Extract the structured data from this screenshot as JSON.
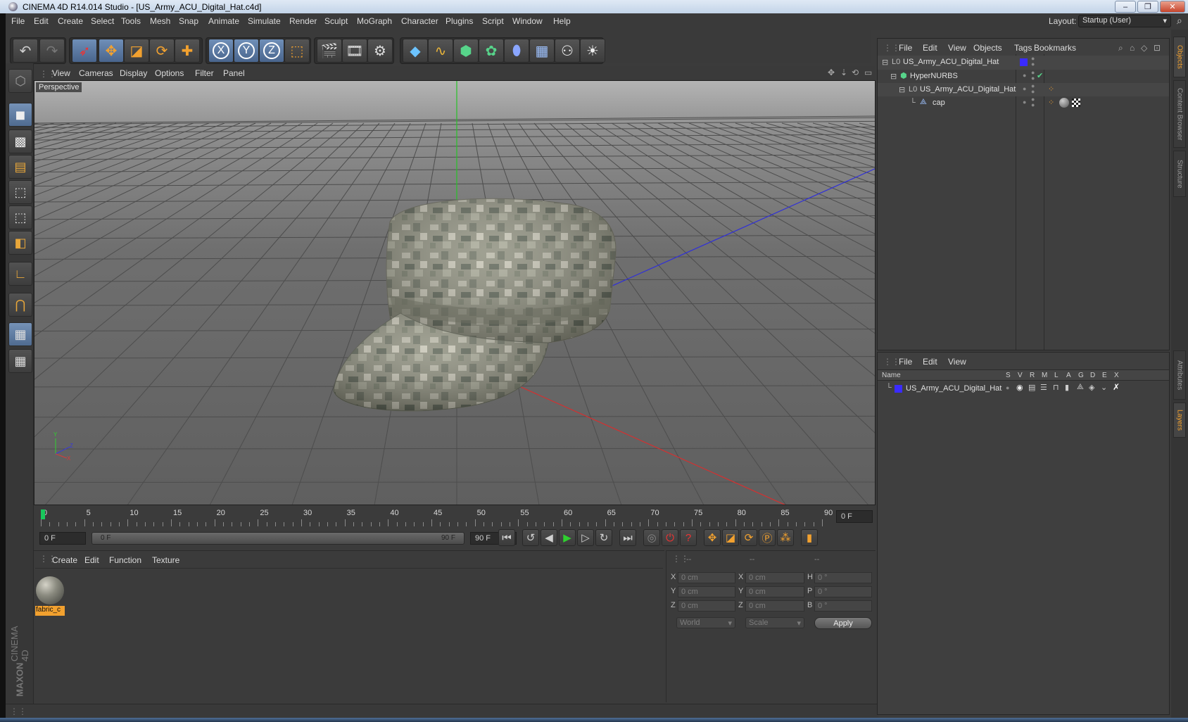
{
  "window": {
    "title": "CINEMA 4D R14.014 Studio - [US_Army_ACU_Digital_Hat.c4d]",
    "min": "–",
    "max": "❐",
    "close": "✕"
  },
  "menubar": {
    "items": [
      "File",
      "Edit",
      "Create",
      "Select",
      "Tools",
      "Mesh",
      "Snap",
      "Animate",
      "Simulate",
      "Render",
      "Sculpt",
      "MoGraph",
      "Character",
      "Plugins",
      "Script",
      "Window",
      "Help"
    ],
    "layout_label": "Layout:",
    "layout_value": "Startup (User)"
  },
  "toolbar": {
    "icons": [
      "undo-icon",
      "redo-icon",
      "live-selection-icon",
      "move-icon",
      "scale-icon",
      "rotate-icon",
      "add-icon",
      "x-axis-icon",
      "y-axis-icon",
      "z-axis-icon",
      "world-coords-icon",
      "render-view-icon",
      "render-picture-viewer-icon",
      "render-settings-icon",
      "cube-icon",
      "spline-icon",
      "nurbs-icon",
      "array-icon",
      "deformer-icon",
      "floor-icon",
      "camera-icon",
      "light-icon"
    ],
    "x": "X",
    "y": "Y",
    "z": "Z"
  },
  "viewport": {
    "menu": [
      "View",
      "Cameras",
      "Display",
      "Options",
      "Filter",
      "Panel"
    ],
    "label": "Perspective",
    "axis_y": "Y",
    "axis_z": "Z",
    "axis_x": "X"
  },
  "timeline": {
    "ticks": [
      "0",
      "5",
      "10",
      "15",
      "20",
      "25",
      "30",
      "35",
      "40",
      "45",
      "50",
      "55",
      "60",
      "65",
      "70",
      "75",
      "80",
      "85",
      "90"
    ],
    "current_frame": "0 F",
    "start_field": "0 F",
    "range_start": "0 F",
    "range_end": "90 F",
    "end_field": "90 F"
  },
  "material_manager": {
    "menu": [
      "Create",
      "Edit",
      "Function",
      "Texture"
    ],
    "material_name": "fabric_c"
  },
  "coords": {
    "header": [
      "--",
      "--",
      "--"
    ],
    "x_pos": "0 cm",
    "y_pos": "0 cm",
    "z_pos": "0 cm",
    "x_size": "0 cm",
    "y_size": "0 cm",
    "z_size": "0 cm",
    "h": "0 °",
    "p": "0 °",
    "b": "0 °",
    "lbl_x": "X",
    "lbl_y": "Y",
    "lbl_z": "Z",
    "lbl_h": "H",
    "lbl_p": "P",
    "lbl_b": "B",
    "mode": "World",
    "scale": "Scale",
    "apply": "Apply"
  },
  "object_manager": {
    "menu": [
      "File",
      "Edit",
      "View",
      "Objects",
      "Tags",
      "Bookmarks"
    ],
    "objects": [
      {
        "name": "US_Army_ACU_Digital_Hat",
        "level": 0
      },
      {
        "name": "HyperNURBS",
        "level": 1
      },
      {
        "name": "US_Army_ACU_Digital_Hat",
        "level": 2
      },
      {
        "name": "cap",
        "level": 3
      }
    ]
  },
  "layer_manager": {
    "menu": [
      "File",
      "Edit",
      "View"
    ],
    "columns": [
      "Name",
      "S",
      "V",
      "R",
      "M",
      "L",
      "A",
      "G",
      "D",
      "E",
      "X"
    ],
    "layer_name": "US_Army_ACU_Digital_Hat"
  },
  "side_tabs": [
    "Objects",
    "Content Browser",
    "Structure",
    "Attributes",
    "Layers"
  ],
  "branding": {
    "line1": "MAXON",
    "line2": "CINEMA 4D"
  },
  "colors": {
    "accent": "#f2a12f",
    "layer_color": "#3a2bff",
    "selection_blue": "#5a78a0"
  }
}
